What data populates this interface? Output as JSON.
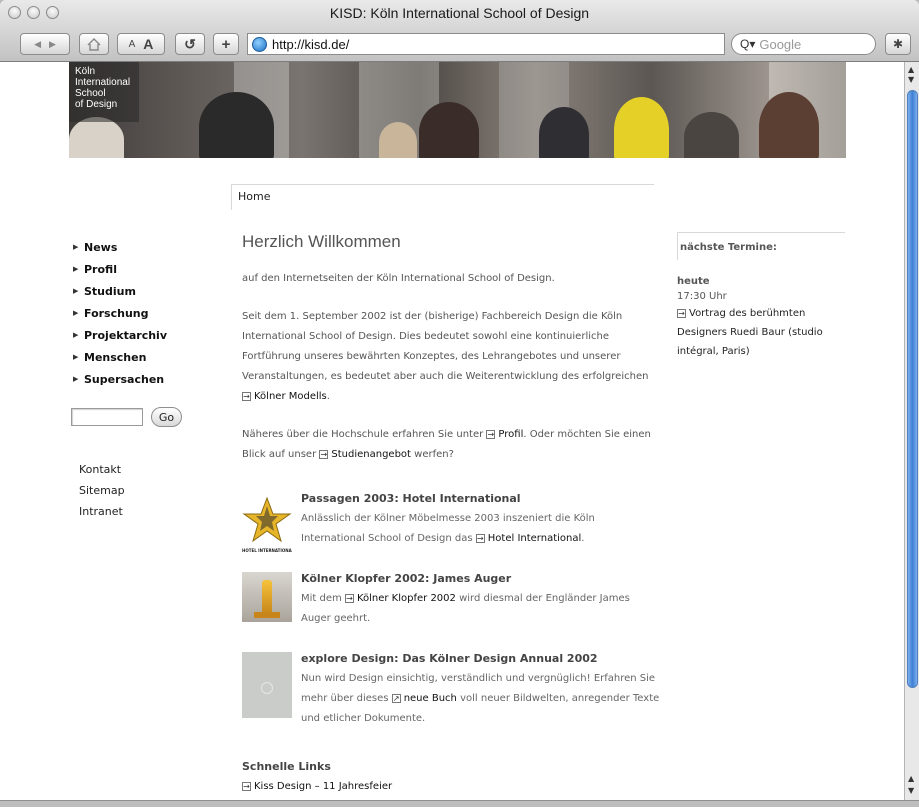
{
  "browser": {
    "title": "KISD: Köln International School of Design",
    "url": "http://kisd.de/",
    "search_placeholder": "Google",
    "buttons": {
      "text_smaller": "A",
      "text_larger": "A"
    }
  },
  "logo": {
    "lines": [
      "Köln",
      "International",
      "School",
      "of Design"
    ]
  },
  "breadcrumb": "Home",
  "nav": {
    "items": [
      "News",
      "Profil",
      "Studium",
      "Forschung",
      "Projektarchiv",
      "Menschen",
      "Supersachen"
    ],
    "go_label": "Go",
    "secondary": [
      "Kontakt",
      "Sitemap",
      "Intranet"
    ]
  },
  "main": {
    "heading": "Herzlich Willkommen",
    "intro": "auf den Internetseiten der Köln International School of Design.",
    "para2_a": "Seit dem 1. September 2002 ist der (bisherige) Fachbereich Design die Köln International School of Design. Dies bedeutet sowohl eine kontinuierliche Fortführung unseres bewährten Konzeptes, des Lehrangebotes und unserer Veranstaltungen, es bedeutet aber auch die Weiterentwicklung des erfolgreichen",
    "para2_link": "Kölner Modells",
    "para2_end": ".",
    "para3_a": "Näheres über die Hochschule erfahren Sie unter",
    "para3_link1": "Profil",
    "para3_b": ". Oder möchten Sie einen Blick auf unser",
    "para3_link2": "Studienangebot",
    "para3_end": "werfen?"
  },
  "news": [
    {
      "title": "Passagen 2003: Hotel International",
      "text_a": "Anlässlich der Kölner Möbelmesse 2003 inszeniert die Köln International School of Design das",
      "link": "Hotel International",
      "text_b": ".",
      "thumb_caption": "HOTEL INTERNATIONAL"
    },
    {
      "title": "Kölner Klopfer 2002: James Auger",
      "text_a": "Mit dem",
      "link": "Kölner Klopfer 2002",
      "text_b": "wird diesmal der Engländer James Auger geehrt."
    },
    {
      "title": "explore Design: Das Kölner Design Annual 2002",
      "text_a": "Nun wird Design einsichtig, verständlich und vergnüglich! Erfahren Sie mehr über dieses",
      "link": "neue Buch",
      "text_b": "voll neuer Bildwelten, anregender Texte und etlicher Dokumente."
    }
  ],
  "quick_links": {
    "heading": "Schnelle Links",
    "items": [
      "Kiss Design – 11 Jahresfeier"
    ]
  },
  "events": {
    "heading": "nächste Termine:",
    "day": "heute",
    "time": "17:30 Uhr",
    "description": "Vortrag des berühmten Designers Ruedi Baur (studio intégral, Paris)"
  },
  "colors": {
    "scroll_thumb": "#3d7fd4",
    "text_grey": "#555555",
    "link": "#111111"
  }
}
